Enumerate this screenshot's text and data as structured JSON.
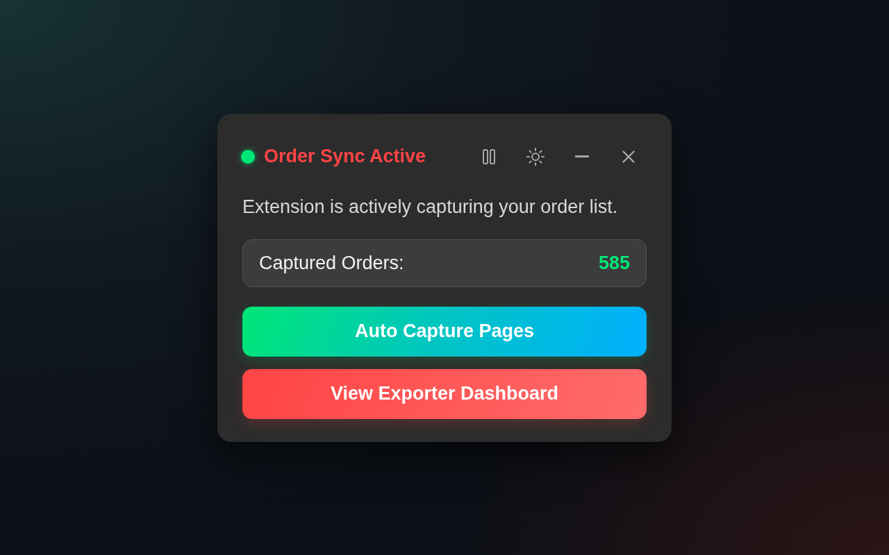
{
  "panel": {
    "status": {
      "active": true
    },
    "title": "Order Sync Active",
    "description": "Extension is actively capturing your order list.",
    "counter": {
      "label": "Captured Orders:",
      "value": "585"
    },
    "buttons": [
      {
        "label": "Auto Capture Pages",
        "kind": "primary"
      },
      {
        "label": "View Exporter Dashboard",
        "kind": "danger"
      }
    ]
  }
}
